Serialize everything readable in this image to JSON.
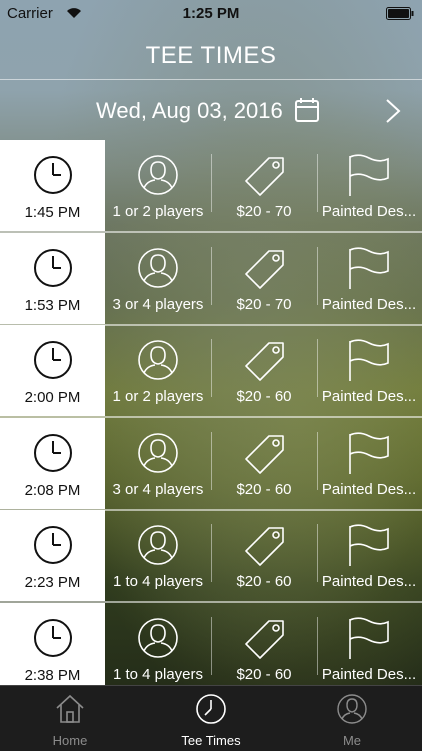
{
  "status_bar": {
    "carrier": "Carrier",
    "time": "1:25 PM"
  },
  "header": {
    "title": "TEE TIMES"
  },
  "date_bar": {
    "date": "Wed, Aug 03, 2016"
  },
  "tee_times": [
    {
      "time": "1:45 PM",
      "players": "1 or 2 players",
      "price": "$20 - 70",
      "course": "Painted Des..."
    },
    {
      "time": "1:53 PM",
      "players": "3 or 4 players",
      "price": "$20 - 70",
      "course": "Painted Des..."
    },
    {
      "time": "2:00 PM",
      "players": "1 or 2 players",
      "price": "$20 - 60",
      "course": "Painted Des..."
    },
    {
      "time": "2:08 PM",
      "players": "3 or 4 players",
      "price": "$20 - 60",
      "course": "Painted Des..."
    },
    {
      "time": "2:23 PM",
      "players": "1 to 4 players",
      "price": "$20 - 60",
      "course": "Painted Des..."
    },
    {
      "time": "2:38 PM",
      "players": "1 to 4 players",
      "price": "$20 - 60",
      "course": "Painted Des..."
    }
  ],
  "tab_bar": {
    "tabs": [
      {
        "label": "Home",
        "icon": "home-icon"
      },
      {
        "label": "Tee Times",
        "icon": "clock-icon"
      },
      {
        "label": "Me",
        "icon": "person-icon"
      }
    ],
    "active": "Tee Times"
  }
}
